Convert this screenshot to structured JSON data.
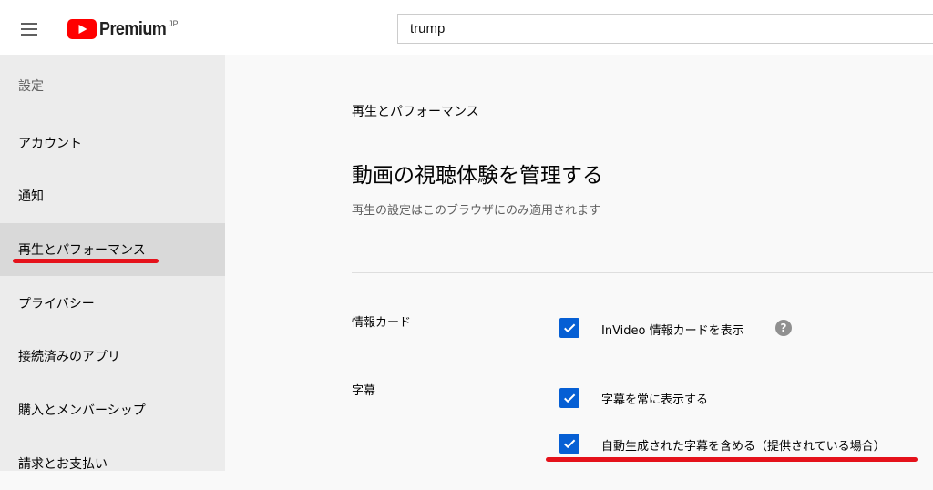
{
  "header": {
    "logo_text": "Premium",
    "logo_region": "JP",
    "search_value": "trump",
    "brand_color": "#ff0000"
  },
  "nav": {
    "title": "設定",
    "items": [
      {
        "label": "アカウント"
      },
      {
        "label": "通知"
      },
      {
        "label": "再生とパフォーマンス",
        "active": true
      },
      {
        "label": "プライバシー"
      },
      {
        "label": "接続済みのアプリ"
      },
      {
        "label": "購入とメンバーシップ"
      },
      {
        "label": "請求とお支払い"
      }
    ]
  },
  "main": {
    "section_label": "再生とパフォーマンス",
    "heading": "動画の視聴体験を管理する",
    "subtext": "再生の設定はこのブラウザにのみ適用されます",
    "info_cards": {
      "label": "情報カード",
      "option": "InVideo 情報カードを表示",
      "checked": true
    },
    "captions": {
      "label": "字幕",
      "options": [
        {
          "label": "字幕を常に表示する",
          "checked": true
        },
        {
          "label": "自動生成された字幕を含める（提供されている場合）",
          "checked": true
        }
      ]
    },
    "checkbox_color": "#065fd4",
    "highlight_color": "#e5121b"
  }
}
